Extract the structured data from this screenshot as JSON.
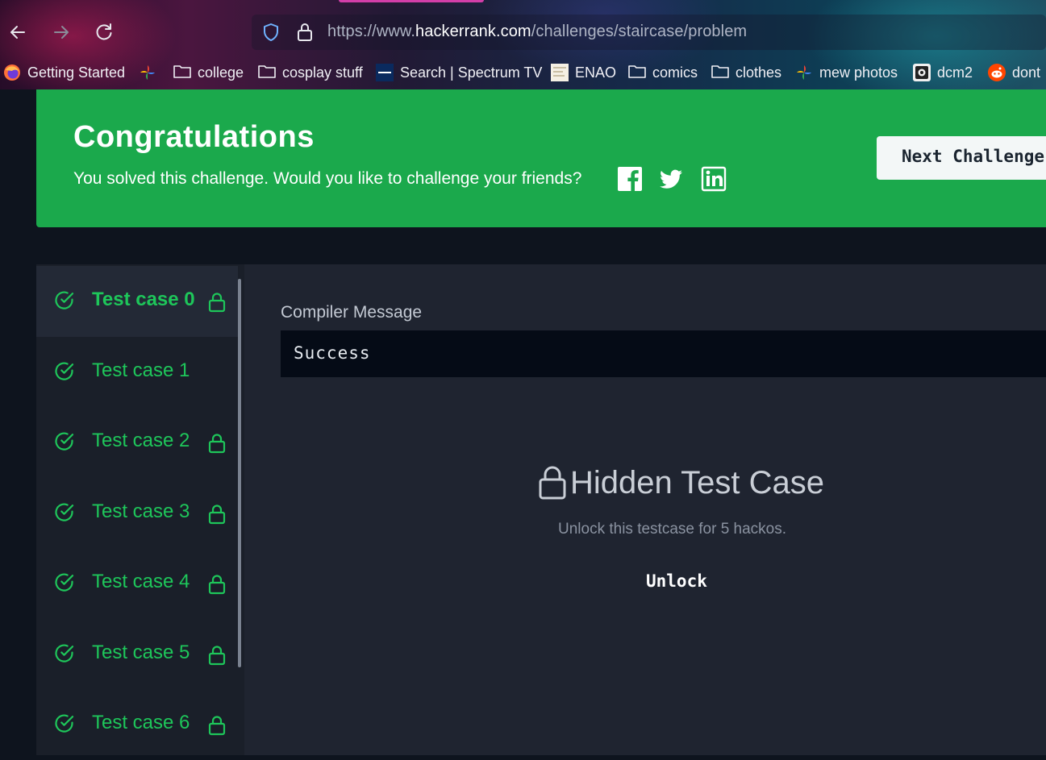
{
  "browser": {
    "url_prefix": "https://www.",
    "url_host": "hackerrank.com",
    "url_path": "/challenges/staircase/problem",
    "bookmarks": [
      {
        "label": "Getting Started",
        "icon": "firefox-icon"
      },
      {
        "label": "",
        "icon": "pinwheel-icon"
      },
      {
        "label": "college",
        "icon": "folder-icon"
      },
      {
        "label": "cosplay stuff",
        "icon": "folder-icon"
      },
      {
        "label": "Search | Spectrum TV",
        "icon": "spectrum-icon"
      },
      {
        "label": "ENAO",
        "icon": "enao-icon"
      },
      {
        "label": "comics",
        "icon": "folder-icon"
      },
      {
        "label": "clothes",
        "icon": "folder-icon"
      },
      {
        "label": "mew photos",
        "icon": "pinwheel-icon"
      },
      {
        "label": "dcm2",
        "icon": "dcm-icon"
      },
      {
        "label": "dont",
        "icon": "reddit-icon"
      }
    ]
  },
  "banner": {
    "title": "Congratulations",
    "subtitle": "You solved this challenge. Would you like to challenge your friends?",
    "next_label": "Next Challenge",
    "colors": {
      "background": "#1ba94c",
      "text": "#ffffff"
    }
  },
  "test_cases": [
    {
      "label": "Test case 0",
      "locked": true,
      "active": true
    },
    {
      "label": "Test case 1",
      "locked": false,
      "active": false
    },
    {
      "label": "Test case 2",
      "locked": true,
      "active": false
    },
    {
      "label": "Test case 3",
      "locked": true,
      "active": false
    },
    {
      "label": "Test case 4",
      "locked": true,
      "active": false
    },
    {
      "label": "Test case 5",
      "locked": true,
      "active": false
    },
    {
      "label": "Test case 6",
      "locked": true,
      "active": false
    }
  ],
  "result": {
    "compiler_label": "Compiler Message",
    "compiler_message": "Success",
    "hidden_title": "Hidden Test Case",
    "hidden_subtitle": "Unlock this testcase for 5 hackos.",
    "unlock_label": "Unlock",
    "colors": {
      "pass": "#1ec65a",
      "panel": "#1f2430"
    }
  }
}
